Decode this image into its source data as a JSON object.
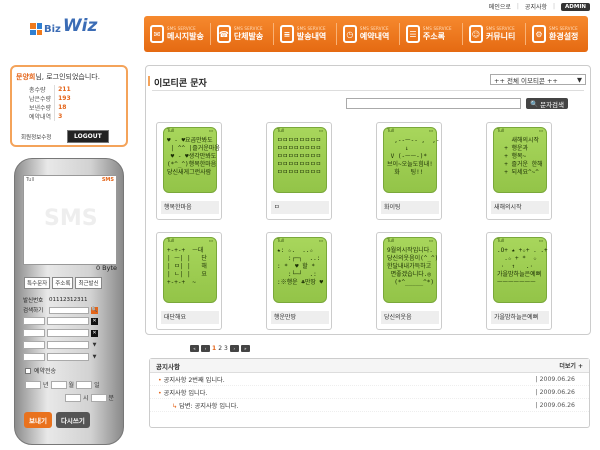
{
  "brand": {
    "logo_small": "Biz",
    "logo_big": "Wiz"
  },
  "top_links": {
    "home": "메인으로",
    "notice": "공지사항",
    "admin": "ADMIN"
  },
  "nav": [
    {
      "sub": "SMS SERVICE",
      "label": "메시지발송",
      "icon": "message-icon"
    },
    {
      "sub": "SMS SERVICE",
      "label": "단체발송",
      "icon": "group-send-icon"
    },
    {
      "sub": "SMS SERVICE",
      "label": "발송내역",
      "icon": "history-icon"
    },
    {
      "sub": "SMS SERVICE",
      "label": "예약내역",
      "icon": "reservation-icon"
    },
    {
      "sub": "SMS SERVICE",
      "label": "주소록",
      "icon": "addressbook-icon"
    },
    {
      "sub": "SMS SERVICE",
      "label": "커뮤니티",
      "icon": "community-icon"
    },
    {
      "sub": "SMS SERVICE",
      "label": "환경설정",
      "icon": "settings-icon"
    }
  ],
  "login": {
    "user": "문양희",
    "greeting": "님, 로그인되었습니다.",
    "stats": [
      {
        "label": "총수량",
        "value": "211"
      },
      {
        "label": "남은수량",
        "value": "193"
      },
      {
        "label": "보낸수량",
        "value": "18"
      },
      {
        "label": "예약내역",
        "value": "3"
      }
    ],
    "edit_info": "회원정보수정",
    "logout": "LOGOUT"
  },
  "phone": {
    "status_left": "Tull",
    "status_right": "SMS",
    "watermark": "SMS",
    "bytes": "0 Byte",
    "buttons": [
      "특수문자",
      "주소록",
      "최근발신"
    ],
    "sender_label": "발신번호",
    "sender_value": "01112312311",
    "search_label": "검색하기",
    "reserve_label": "예약전송",
    "date_labels": {
      "year": "년",
      "month": "월",
      "day": "일",
      "hour": "시",
      "minute": "분"
    },
    "send": "보내기",
    "rewrite": "다시쓰기"
  },
  "main": {
    "title": "이모티콘 문자",
    "category_select": "++ 전체 이모티콘 ++",
    "search_placeholder": "",
    "search_button": "문자검색",
    "cards": [
      {
        "name": "행복한마음",
        "text": "♥ - ♥요곱만봐도\n | ^^ |즐거운마음\n ♥ - ♥생각만봐도\n(*^_^)행복한마음\n당신새게그런사람"
      },
      {
        "name": "ㅁ",
        "text": "ㅁㅁㅁㅁㅁㅁㅁㅁ\nㅁㅁㅁㅁㅁㅁㅁㅁ\nㅁㅁㅁㅁㅁㅁㅁㅁ\nㅁㅁㅁㅁㅁㅁㅁㅁ\nㅁㅁㅁㅁㅁㅁㅁㅁ"
      },
      {
        "name": "화이팅",
        "text": "  ,--ㅡ-- ,  ,-\n     ↓     \n V (-ㅡㅡ-)* \n브이~오늘도힘내!\n  화   팅!!"
      },
      {
        "name": "새해의시작",
        "text": "    새해의시작\n  + 행운과\n  + 행복~\n  + 즐거운 한해\n  + 되세요^~^"
      },
      {
        "name": "대단해요",
        "text": "+-+-+  ㅡ대\n| ㅡ| |   단\n| ㅁ| |   해\n| ㄴ| |   요\n+-+-+  ~"
      },
      {
        "name": "행운만땅",
        "text": "★: ☆.  ..☆\n   :┌─┐  ..:\n: *  ♥ 할 *\n   :└─┘  .:\n:※행운 ♣만땅 ♥"
      },
      {
        "name": "당신의웃음",
        "text": "9월의시작입니다.\n당신의웃음이(^_^)\n한달내내가득하고\n 면좋겠습니다.◎\n  (*^_____^*)"
      },
      {
        "name": "가을밤하늘은예뻐",
        "text": ".O+ ★ +☆+ . .+\n  .☆ + *  ☆\n ·  ↑   .·\n가을밤하늘은예뻐\nㅡㅡㅡㅡㅡㅡㅡ"
      }
    ],
    "pager": {
      "pages": [
        "1",
        "2",
        "3"
      ]
    }
  },
  "notice": {
    "title": "공지사항",
    "more": "더보기 +",
    "rows": [
      {
        "title": "공지사항 2번째 입니다.",
        "date": "| 2009.06.26",
        "reply": false
      },
      {
        "title": "공지사항 입니다.",
        "date": "| 2009.06.26",
        "reply": false
      },
      {
        "title": "답변: 공지사항 입니다.",
        "date": "| 2009.06.26",
        "reply": true
      }
    ]
  },
  "colors": {
    "accent": "#f07a1c",
    "brand": "#3b6cb5",
    "lcd": "#a8d65c"
  }
}
